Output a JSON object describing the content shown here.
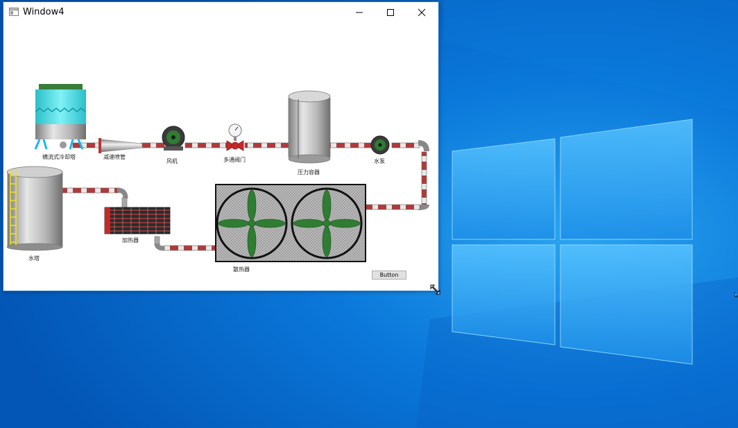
{
  "window": {
    "title": "Window4",
    "button_label": "Button"
  },
  "labels": {
    "cooling_tower": "横流式冷却塔",
    "reducer": "减速喷管",
    "fan": "风机",
    "valve": "多通阀门",
    "pressure_vessel": "压力容器",
    "pump": "水泵",
    "water_tower": "水塔",
    "heater": "加热器",
    "radiator": "散热器"
  },
  "icons": {
    "minimize": "minimize-icon",
    "maximize": "maximize-icon",
    "close": "close-icon"
  },
  "colors": {
    "desktop_blue": "#0a6fd1",
    "pipe_red": "#b03a3a",
    "fan_green": "#2e7d32",
    "tower_cyan": "#3ed6e0"
  }
}
